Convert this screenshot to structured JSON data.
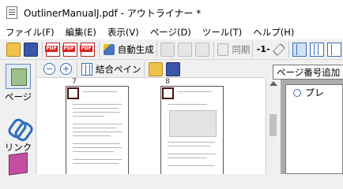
{
  "window": {
    "title": "OutlinerManualJ.pdf - アウトライナー *"
  },
  "menu": [
    "ファイル(F)",
    "編集(E)",
    "表示(V)",
    "ページ(D)",
    "ツール(T)",
    "ヘルプ(H)"
  ],
  "toolbar": {
    "auto_generate_label": "自動生成",
    "sync_label": "同期",
    "page_indicator": "-1-",
    "pdf_badge": "PDF"
  },
  "tooltip": "ページ番号追加",
  "sidebar": {
    "page_label": "ページ",
    "link_label": "リンク"
  },
  "pages_toolbar": {
    "combine_pane_label": "結合ペイン"
  },
  "thumbnails": [
    {
      "number": "7"
    },
    {
      "number": "8"
    }
  ],
  "right_pane": {
    "item_label": "プレ"
  }
}
